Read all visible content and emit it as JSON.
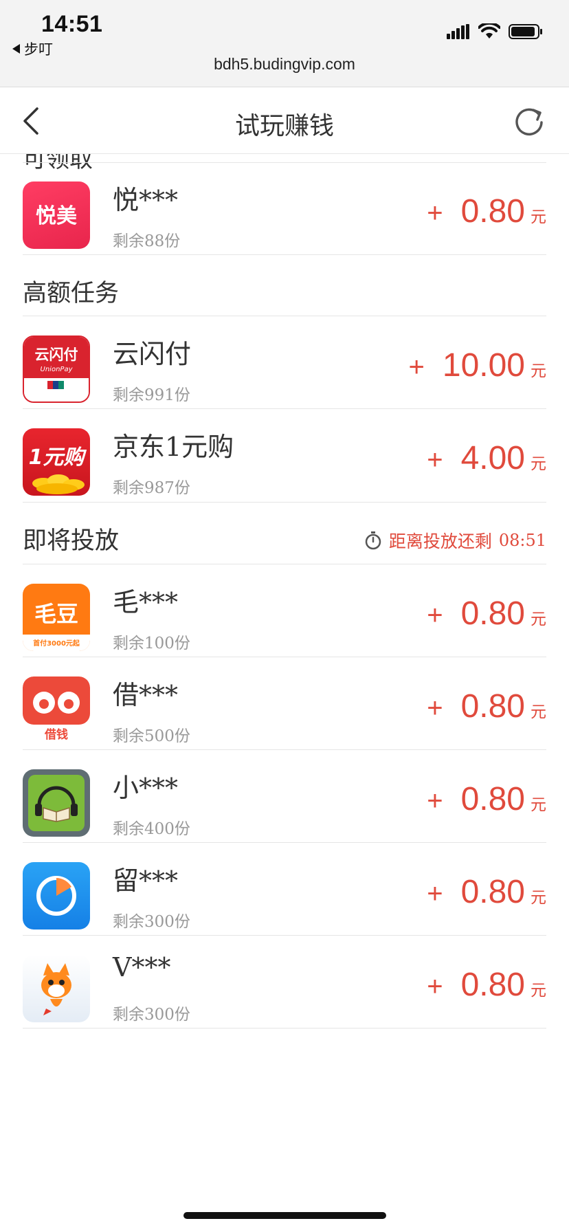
{
  "status_bar": {
    "time": "14:51",
    "back_app": "步叮",
    "url": "bdh5.budingvip.com",
    "icons": [
      "signal-icon",
      "wifi-icon",
      "battery-icon"
    ]
  },
  "header": {
    "title": "试玩赚钱",
    "back_icon": "chevron-left-icon",
    "refresh_icon": "refresh-icon"
  },
  "partial_section_title": "可领取",
  "plus_sign": "+",
  "currency_unit": "元",
  "groups": [
    {
      "apps": [
        {
          "name": "悦***",
          "remain": "剩余88份",
          "reward": "0.80",
          "icon": "yuemei-app-icon",
          "icon_text": "悦美"
        }
      ]
    },
    {
      "title": "高额任务",
      "apps": [
        {
          "name": "云闪付",
          "remain": "剩余991份",
          "reward": "10.00",
          "icon": "unionpay-app-icon",
          "icon_text": "云闪付",
          "icon_subtext": "UnionPay"
        },
        {
          "name": "京东1元购",
          "remain": "剩余987份",
          "reward": "4.00",
          "icon": "jd-1yuan-app-icon",
          "icon_text": "1元购"
        }
      ]
    },
    {
      "title": "即将投放",
      "countdown_label": "距离投放还剩",
      "countdown_time": "08:51",
      "apps": [
        {
          "name": "毛***",
          "remain": "剩余100份",
          "reward": "0.80",
          "icon": "maodou-app-icon",
          "icon_text": "毛豆",
          "icon_subtext": "首付3000元起"
        },
        {
          "name": "借***",
          "remain": "剩余500份",
          "reward": "0.80",
          "icon": "jieqian-app-icon",
          "icon_text": "借钱"
        },
        {
          "name": "小***",
          "remain": "剩余400份",
          "reward": "0.80",
          "icon": "audiobook-app-icon"
        },
        {
          "name": "留***",
          "remain": "剩余300份",
          "reward": "0.80",
          "icon": "timer-app-icon"
        },
        {
          "name": "V***",
          "remain": "剩余300份",
          "reward": "0.80",
          "icon": "fox-app-icon"
        }
      ]
    }
  ],
  "colors": {
    "accent": "#e04a3c",
    "muted_text": "#999999",
    "divider": "#e5e5e5"
  }
}
